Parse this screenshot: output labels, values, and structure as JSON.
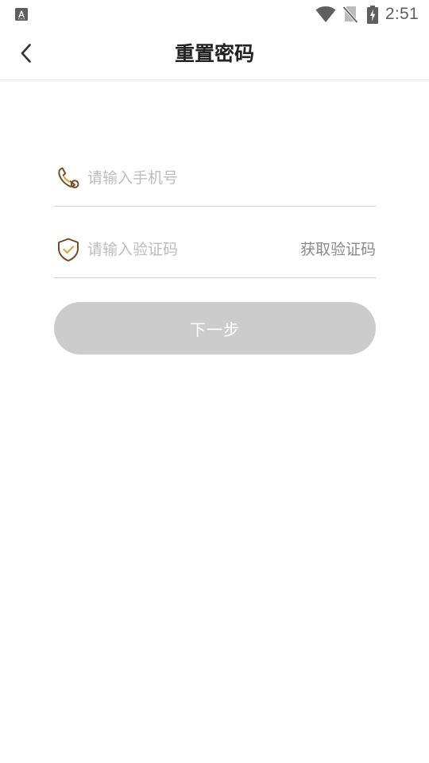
{
  "status_bar": {
    "time": "2:51",
    "left_icon": "keyboard-a-icon",
    "icons": [
      "wifi-icon",
      "no-sim-icon",
      "battery-charging-icon"
    ]
  },
  "header": {
    "title": "重置密码",
    "back_icon": "chevron-left-icon"
  },
  "form": {
    "phone": {
      "icon": "phone-icon",
      "placeholder": "请输入手机号",
      "value": ""
    },
    "code": {
      "icon": "shield-check-icon",
      "placeholder": "请输入验证码",
      "value": "",
      "get_code_label": "获取验证码"
    },
    "next_label": "下一步"
  },
  "colors": {
    "accent_brown": "#7a4a22",
    "accent_orange": "#e2a03c",
    "button_disabled": "#cccccc",
    "divider": "#d2d2d2"
  }
}
